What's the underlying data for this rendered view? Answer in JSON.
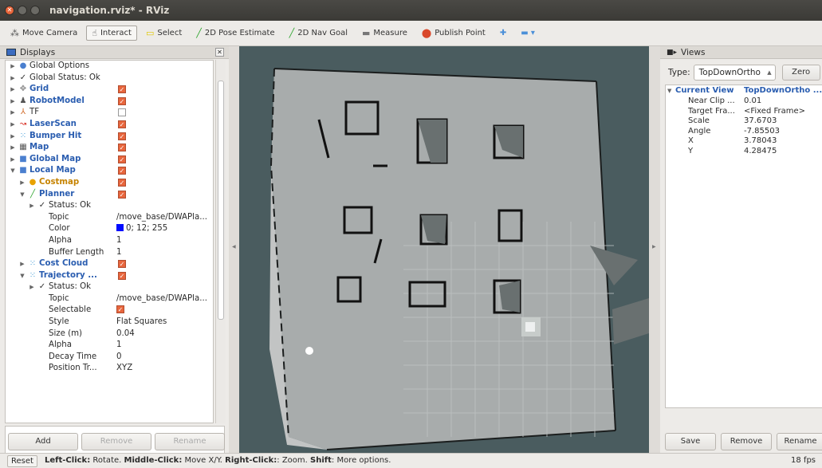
{
  "window": {
    "title": "navigation.rviz* - RViz"
  },
  "toolbar": {
    "tools": [
      {
        "label": "Move Camera",
        "icon": "move-camera-icon",
        "glyph": "⁂",
        "color": "#555555",
        "active": false
      },
      {
        "label": "Interact",
        "icon": "interact-icon",
        "glyph": "☝",
        "color": "#555555",
        "active": true
      },
      {
        "label": "Select",
        "icon": "select-icon",
        "glyph": "▭",
        "color": "#e0c800",
        "active": false
      },
      {
        "label": "2D Pose Estimate",
        "icon": "pose-estimate-icon",
        "glyph": "╱",
        "color": "#2fa52f",
        "active": false
      },
      {
        "label": "2D Nav Goal",
        "icon": "nav-goal-icon",
        "glyph": "╱",
        "color": "#2fa52f",
        "active": false
      },
      {
        "label": "Measure",
        "icon": "measure-icon",
        "glyph": "▬",
        "color": "#777777",
        "active": false
      },
      {
        "label": "Publish Point",
        "icon": "publish-point-icon",
        "glyph": "⬤",
        "color": "#d9482b",
        "active": false
      }
    ],
    "add_tool_icon": "plus-icon",
    "remove_tool_icon": "minus-dropdown-icon"
  },
  "displays": {
    "title": "Displays",
    "rows": [
      {
        "name": "Global Options",
        "depth": 0,
        "arrow": "▶",
        "icon": "globe-icon",
        "glyph": "●",
        "icolor": "#4a7fcf",
        "style": "",
        "check": null,
        "value": ""
      },
      {
        "name": "Global Status: Ok",
        "depth": 0,
        "arrow": "▶",
        "icon": "status-ok-icon",
        "glyph": "✓",
        "icolor": "#333333",
        "style": "",
        "check": null,
        "value": ""
      },
      {
        "name": "Grid",
        "depth": 0,
        "arrow": "▶",
        "icon": "grid-icon",
        "glyph": "✥",
        "icolor": "#888888",
        "style": "blue",
        "check": true,
        "value": ""
      },
      {
        "name": "RobotModel",
        "depth": 0,
        "arrow": "▶",
        "icon": "robot-model-icon",
        "glyph": "♟",
        "icolor": "#555555",
        "style": "blue",
        "check": true,
        "value": ""
      },
      {
        "name": "TF",
        "depth": 0,
        "arrow": "▶",
        "icon": "tf-icon",
        "glyph": "⅄",
        "icolor": "#d06b2a",
        "style": "",
        "check": false,
        "value": ""
      },
      {
        "name": "LaserScan",
        "depth": 0,
        "arrow": "▶",
        "icon": "laser-scan-icon",
        "glyph": "↝",
        "icolor": "#d9362b",
        "style": "blue",
        "check": true,
        "value": ""
      },
      {
        "name": "Bumper Hit",
        "depth": 0,
        "arrow": "▶",
        "icon": "bumper-hit-icon",
        "glyph": "⁙",
        "icolor": "#4aa0d8",
        "style": "blue",
        "check": true,
        "value": ""
      },
      {
        "name": "Map",
        "depth": 0,
        "arrow": "▶",
        "icon": "map-icon",
        "glyph": "▦",
        "icolor": "#555555",
        "style": "blue",
        "check": true,
        "value": ""
      },
      {
        "name": "Global Map",
        "depth": 0,
        "arrow": "▶",
        "icon": "folder-icon",
        "glyph": "■",
        "icolor": "#4a7fcf",
        "style": "blue",
        "check": true,
        "value": ""
      },
      {
        "name": "Local Map",
        "depth": 0,
        "arrow": "▼",
        "icon": "folder-icon",
        "glyph": "■",
        "icolor": "#4a7fcf",
        "style": "blue",
        "check": true,
        "value": ""
      },
      {
        "name": "Costmap",
        "depth": 1,
        "arrow": "▶",
        "icon": "warning-icon",
        "glyph": "●",
        "icolor": "#e8a200",
        "style": "orange",
        "check": true,
        "value": ""
      },
      {
        "name": "Planner",
        "depth": 1,
        "arrow": "▼",
        "icon": "path-icon",
        "glyph": "╱",
        "icolor": "#2fa52f",
        "style": "green",
        "check": true,
        "value": ""
      },
      {
        "name": "Status: Ok",
        "depth": 2,
        "arrow": "▶",
        "icon": "status-ok-icon",
        "glyph": "✓",
        "icolor": "#333333",
        "style": "",
        "check": null,
        "value": ""
      },
      {
        "name": "Topic",
        "depth": 3,
        "arrow": "",
        "icon": "",
        "glyph": "",
        "icolor": "",
        "style": "",
        "check": null,
        "value": "/move_base/DWAPla..."
      },
      {
        "name": "Color",
        "depth": 3,
        "arrow": "",
        "icon": "",
        "glyph": "",
        "icolor": "",
        "style": "",
        "check": null,
        "value": "0; 12; 255",
        "swatch": "#000cff"
      },
      {
        "name": "Alpha",
        "depth": 3,
        "arrow": "",
        "icon": "",
        "glyph": "",
        "icolor": "",
        "style": "",
        "check": null,
        "value": "1"
      },
      {
        "name": "Buffer Length",
        "depth": 3,
        "arrow": "",
        "icon": "",
        "glyph": "",
        "icolor": "",
        "style": "",
        "check": null,
        "value": "1"
      },
      {
        "name": "Cost Cloud",
        "depth": 1,
        "arrow": "▶",
        "icon": "point-cloud-icon",
        "glyph": "⁙",
        "icolor": "#4aa0d8",
        "style": "blue",
        "check": true,
        "value": ""
      },
      {
        "name": "Trajectory ...",
        "depth": 1,
        "arrow": "▼",
        "icon": "point-cloud-icon",
        "glyph": "⁙",
        "icolor": "#4aa0d8",
        "style": "blue",
        "check": true,
        "value": ""
      },
      {
        "name": "Status: Ok",
        "depth": 2,
        "arrow": "▶",
        "icon": "status-ok-icon",
        "glyph": "✓",
        "icolor": "#333333",
        "style": "",
        "check": null,
        "value": ""
      },
      {
        "name": "Topic",
        "depth": 3,
        "arrow": "",
        "icon": "",
        "glyph": "",
        "icolor": "",
        "style": "",
        "check": null,
        "value": "/move_base/DWAPla..."
      },
      {
        "name": "Selectable",
        "depth": 3,
        "arrow": "",
        "icon": "",
        "glyph": "",
        "icolor": "",
        "style": "",
        "check": null,
        "value": "",
        "valcheck": true
      },
      {
        "name": "Style",
        "depth": 3,
        "arrow": "",
        "icon": "",
        "glyph": "",
        "icolor": "",
        "style": "",
        "check": null,
        "value": "Flat Squares"
      },
      {
        "name": "Size (m)",
        "depth": 3,
        "arrow": "",
        "icon": "",
        "glyph": "",
        "icolor": "",
        "style": "",
        "check": null,
        "value": "0.04"
      },
      {
        "name": "Alpha",
        "depth": 3,
        "arrow": "",
        "icon": "",
        "glyph": "",
        "icolor": "",
        "style": "",
        "check": null,
        "value": "1"
      },
      {
        "name": "Decay Time",
        "depth": 3,
        "arrow": "",
        "icon": "",
        "glyph": "",
        "icolor": "",
        "style": "",
        "check": null,
        "value": "0"
      },
      {
        "name": "Position Tr...",
        "depth": 3,
        "arrow": "",
        "icon": "",
        "glyph": "",
        "icolor": "",
        "style": "",
        "check": null,
        "value": "XYZ"
      }
    ],
    "buttons": {
      "add": "Add",
      "remove": "Remove",
      "rename": "Rename"
    }
  },
  "views": {
    "title": "Views",
    "type_label": "Type:",
    "type_value": "TopDownOrtho",
    "zero_label": "Zero",
    "header": {
      "key": "Current View",
      "value": "TopDownOrtho ..."
    },
    "props": [
      {
        "key": "Near Clip ...",
        "value": "0.01"
      },
      {
        "key": "Target Fra...",
        "value": "<Fixed Frame>"
      },
      {
        "key": "Scale",
        "value": "37.6703"
      },
      {
        "key": "Angle",
        "value": "-7.85503"
      },
      {
        "key": "X",
        "value": "3.78043"
      },
      {
        "key": "Y",
        "value": "4.28475"
      }
    ],
    "buttons": {
      "save": "Save",
      "remove": "Remove",
      "rename": "Rename"
    }
  },
  "status": {
    "reset": "Reset",
    "parts": [
      {
        "t": "Left-Click:",
        "b": true
      },
      {
        "t": " Rotate. ",
        "b": false
      },
      {
        "t": "Middle-Click:",
        "b": true
      },
      {
        "t": " Move X/Y. ",
        "b": false
      },
      {
        "t": "Right-Click:",
        "b": true
      },
      {
        "t": ": Zoom. ",
        "b": false
      },
      {
        "t": "Shift",
        "b": true
      },
      {
        "t": ": More options.",
        "b": false
      }
    ],
    "fps": "18 fps"
  }
}
